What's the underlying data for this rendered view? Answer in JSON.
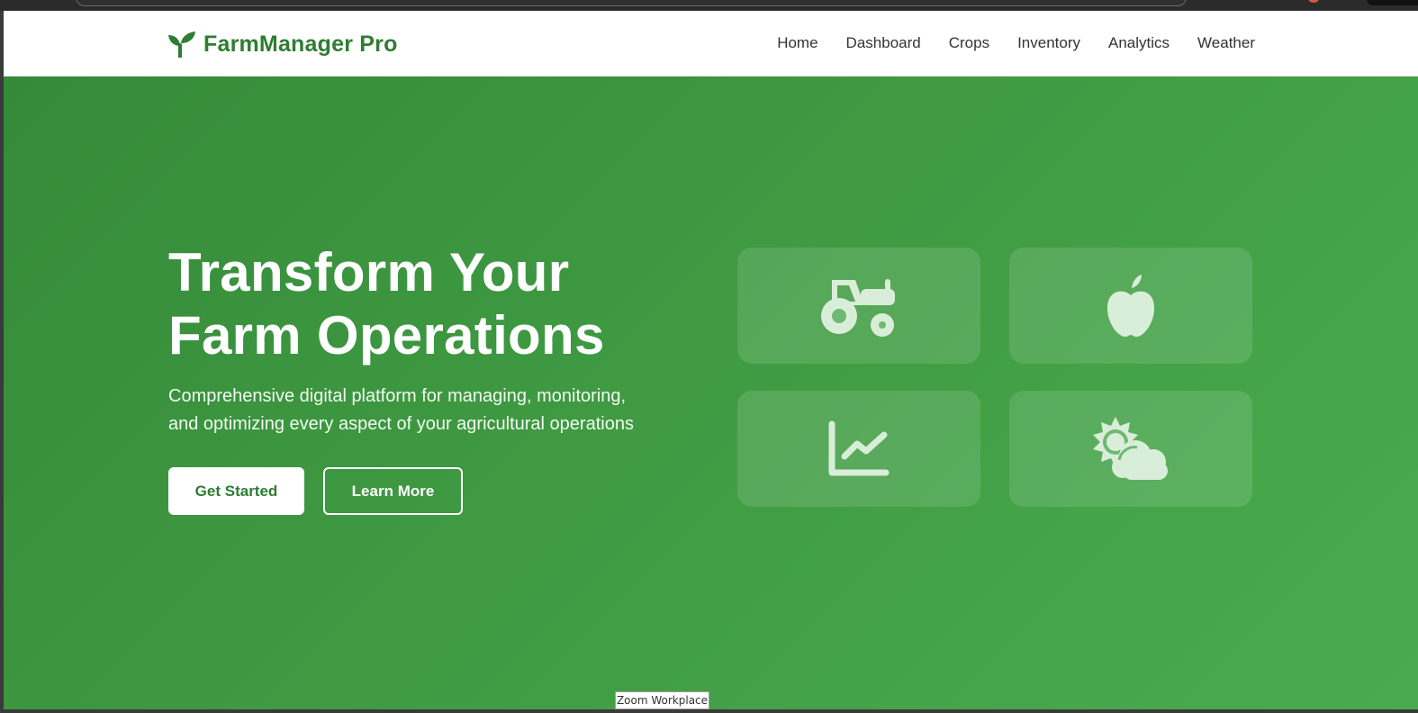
{
  "brand": {
    "name": "FarmManager Pro",
    "icon": "seedling-icon",
    "color": "#2e7d32"
  },
  "nav": {
    "links": [
      {
        "label": "Home"
      },
      {
        "label": "Dashboard"
      },
      {
        "label": "Crops"
      },
      {
        "label": "Inventory"
      },
      {
        "label": "Analytics"
      },
      {
        "label": "Weather"
      }
    ]
  },
  "hero": {
    "title_line1": "Transform Your",
    "title_line2": "Farm Operations",
    "subtitle_line1": "Comprehensive digital platform for managing, monitoring,",
    "subtitle_line2": "and optimizing every aspect of your agricultural operations",
    "primary_button": "Get Started",
    "secondary_button": "Learn More",
    "gradient_start": "#358a39",
    "gradient_end": "#4aab4e"
  },
  "feature_cards": [
    {
      "icon": "tractor-icon"
    },
    {
      "icon": "apple-icon"
    },
    {
      "icon": "chart-line-icon"
    },
    {
      "icon": "cloud-sun-icon"
    }
  ],
  "tooltip": {
    "text": "Zoom Workplace"
  }
}
